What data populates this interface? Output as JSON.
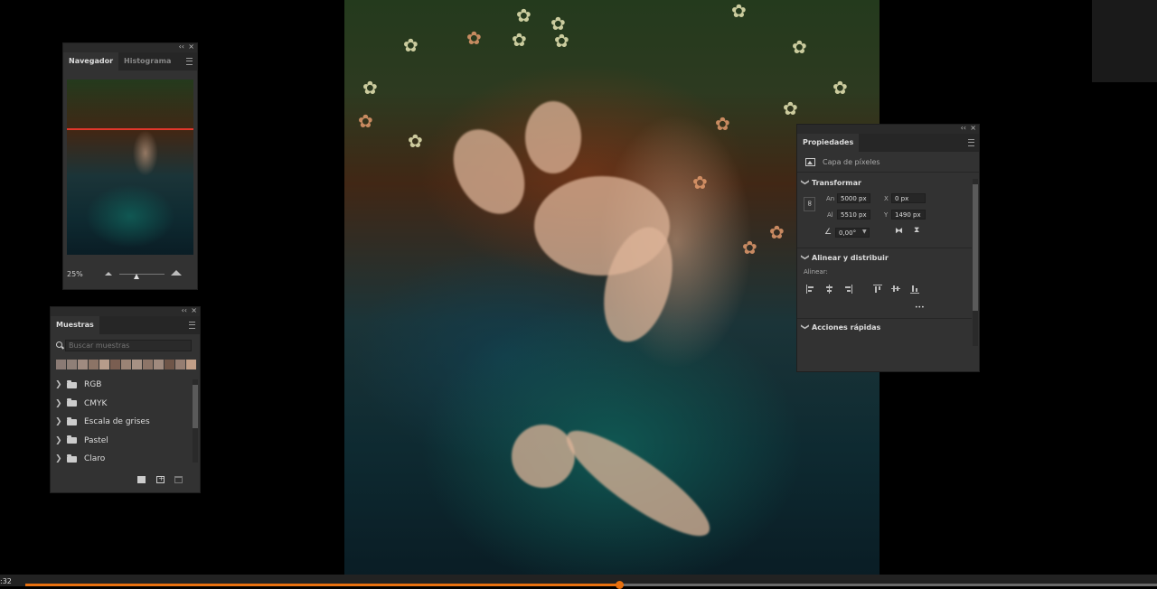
{
  "navigator": {
    "tabs": [
      {
        "label": "Navegador"
      },
      {
        "label": "Histograma"
      }
    ],
    "zoom": "25%"
  },
  "swatches": {
    "tab": "Muestras",
    "search_placeholder": "Buscar muestras",
    "recent_colors": [
      "#8a7a74",
      "#8f7f77",
      "#a08b80",
      "#8c7466",
      "#b79c8b",
      "#7a5e51",
      "#9a8375",
      "#a69184",
      "#8d7568",
      "#a08a7e",
      "#6f5548",
      "#957d71",
      "#c19e87"
    ],
    "groups": [
      {
        "label": "RGB"
      },
      {
        "label": "CMYK"
      },
      {
        "label": "Escala de grises"
      },
      {
        "label": "Pastel"
      },
      {
        "label": "Claro"
      }
    ]
  },
  "properties": {
    "tab": "Propiedades",
    "layer_type": "Capa de píxeles",
    "transform": {
      "title": "Transformar",
      "w_label": "An",
      "w": "5000 px",
      "h_label": "Al",
      "h": "5510 px",
      "x_label": "X",
      "x": "0 px",
      "y_label": "Y",
      "y": "1490 px",
      "angle": "0,00°"
    },
    "align": {
      "title": "Alinear y distribuir",
      "sub": "Alinear:",
      "more": "•••"
    },
    "quick_actions": {
      "title": "Acciones rápidas"
    }
  },
  "player": {
    "time_fragment": ":32",
    "progress": 0.525,
    "colors": {
      "played": "#e8700f",
      "remaining": "#6a6a6a"
    }
  }
}
